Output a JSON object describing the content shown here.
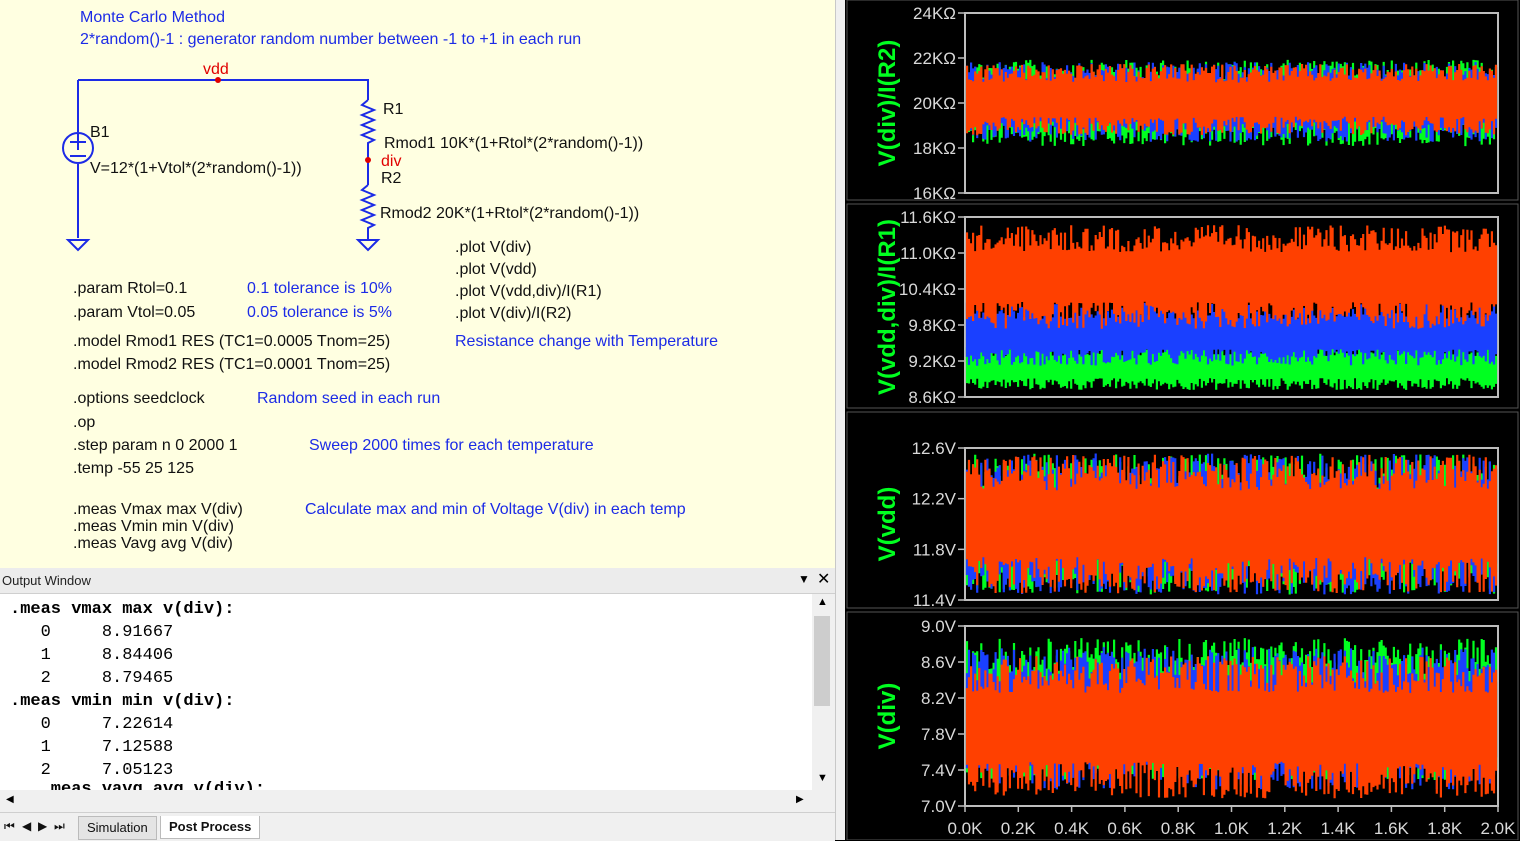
{
  "schematic": {
    "title_line1": "Monte Carlo Method",
    "title_line2": "2*random()-1 : generator random number between -1 to +1 in each run",
    "net_vdd": "vdd",
    "net_div": "div",
    "source_name": "B1",
    "source_value": "V=12*(1+Vtol*(2*random()-1))",
    "r1_name": "R1",
    "r1_value": "Rmod1 10K*(1+Rtol*(2*random()-1))",
    "r2_name": "R2",
    "r2_value": "Rmod2 20K*(1+Rtol*(2*random()-1))",
    "plot_cmds": [
      ".plot V(div)",
      ".plot V(vdd)",
      ".plot V(vdd,div)/I(R1)",
      ".plot V(div)/I(R2)"
    ],
    "param_rtol": ".param Rtol=0.1",
    "param_rtol_note": "0.1 tolerance is 10%",
    "param_vtol": ".param Vtol=0.05",
    "param_vtol_note": "0.05 tolerance is 5%",
    "model1": ".model Rmod1 RES (TC1=0.0005 Tnom=25)",
    "model2": ".model Rmod2 RES (TC1=0.0001 Tnom=25)",
    "model_note": "Resistance change with Temperature",
    "options": ".options seedclock",
    "options_note": "Random seed in each run",
    "op": ".op",
    "step": ".step param n 0 2000 1",
    "step_note": "Sweep 2000 times for each temperature",
    "temp": ".temp -55 25 125",
    "meas1": ".meas Vmax max V(div)",
    "meas2": ".meas Vmin min V(div)",
    "meas3": ".meas Vavg avg V(div)",
    "meas_note": "Calculate max and min of Voltage V(div) in each temp"
  },
  "output": {
    "title": "Output Window",
    "lines": [
      ".meas vmax max v(div):",
      "   0     8.91667",
      "   1     8.84406",
      "   2     8.79465",
      ".meas vmin min v(div):",
      "   0     7.22614",
      "   1     7.12588",
      "   2     7.05123",
      "   .meas vavg avg v(div):"
    ],
    "tabs": [
      "Simulation",
      "Post Process"
    ],
    "active_tab": "Post Process"
  },
  "colors": {
    "accent_blue": "#1c2be6",
    "net_red": "#e00000",
    "trace_orange": "#ff4000",
    "trace_blue": "#1a40ff",
    "trace_green": "#00ff20",
    "trace_black": "#000000"
  },
  "chart_data": [
    {
      "type": "line",
      "ylabel": "V(div)/I(R2)",
      "ylim": [
        16000,
        24000
      ],
      "yticks": [
        "16KΩ",
        "18KΩ",
        "20KΩ",
        "22KΩ",
        "24KΩ"
      ],
      "xlim": [
        0,
        2000
      ],
      "series": [
        {
          "color": "green",
          "band": [
            18000,
            22000
          ]
        },
        {
          "color": "blue",
          "band": [
            18200,
            21900
          ]
        },
        {
          "color": "orange",
          "band": [
            18500,
            21800
          ]
        }
      ]
    },
    {
      "type": "line",
      "ylabel": "V(vdd,div)/I(R1)",
      "ylim": [
        8600,
        11600
      ],
      "yticks": [
        "8.6KΩ",
        "9.2KΩ",
        "9.8KΩ",
        "10.4KΩ",
        "11.0KΩ",
        "11.6KΩ"
      ],
      "xlim": [
        0,
        2000
      ],
      "series": [
        {
          "color": "green",
          "band": [
            8700,
            9500
          ]
        },
        {
          "color": "blue",
          "band": [
            9100,
            10200
          ]
        },
        {
          "color": "orange",
          "band": [
            9700,
            11500
          ]
        }
      ]
    },
    {
      "type": "line",
      "ylabel": "V(vdd)",
      "ylim": [
        11.4,
        12.6
      ],
      "yticks": [
        "11.4V",
        "11.8V",
        "12.2V",
        "12.6V"
      ],
      "xlim": [
        0,
        2000
      ],
      "series": [
        {
          "color": "green",
          "band": [
            11.42,
            12.58
          ]
        },
        {
          "color": "blue",
          "band": [
            11.42,
            12.58
          ]
        },
        {
          "color": "orange",
          "band": [
            11.43,
            12.57
          ]
        }
      ]
    },
    {
      "type": "line",
      "ylabel": "V(div)",
      "ylim": [
        7.0,
        9.0
      ],
      "yticks": [
        "7.0V",
        "7.4V",
        "7.8V",
        "8.2V",
        "8.6V",
        "9.0V"
      ],
      "xlim": [
        0,
        2000
      ],
      "xticks": [
        "0.0K",
        "0.2K",
        "0.4K",
        "0.6K",
        "0.8K",
        "1.0K",
        "1.2K",
        "1.4K",
        "1.6K",
        "1.8K",
        "2.0K"
      ],
      "series": [
        {
          "color": "green",
          "band": [
            7.25,
            8.9
          ]
        },
        {
          "color": "blue",
          "band": [
            7.15,
            8.8
          ]
        },
        {
          "color": "orange",
          "band": [
            7.05,
            8.7
          ]
        }
      ]
    }
  ]
}
